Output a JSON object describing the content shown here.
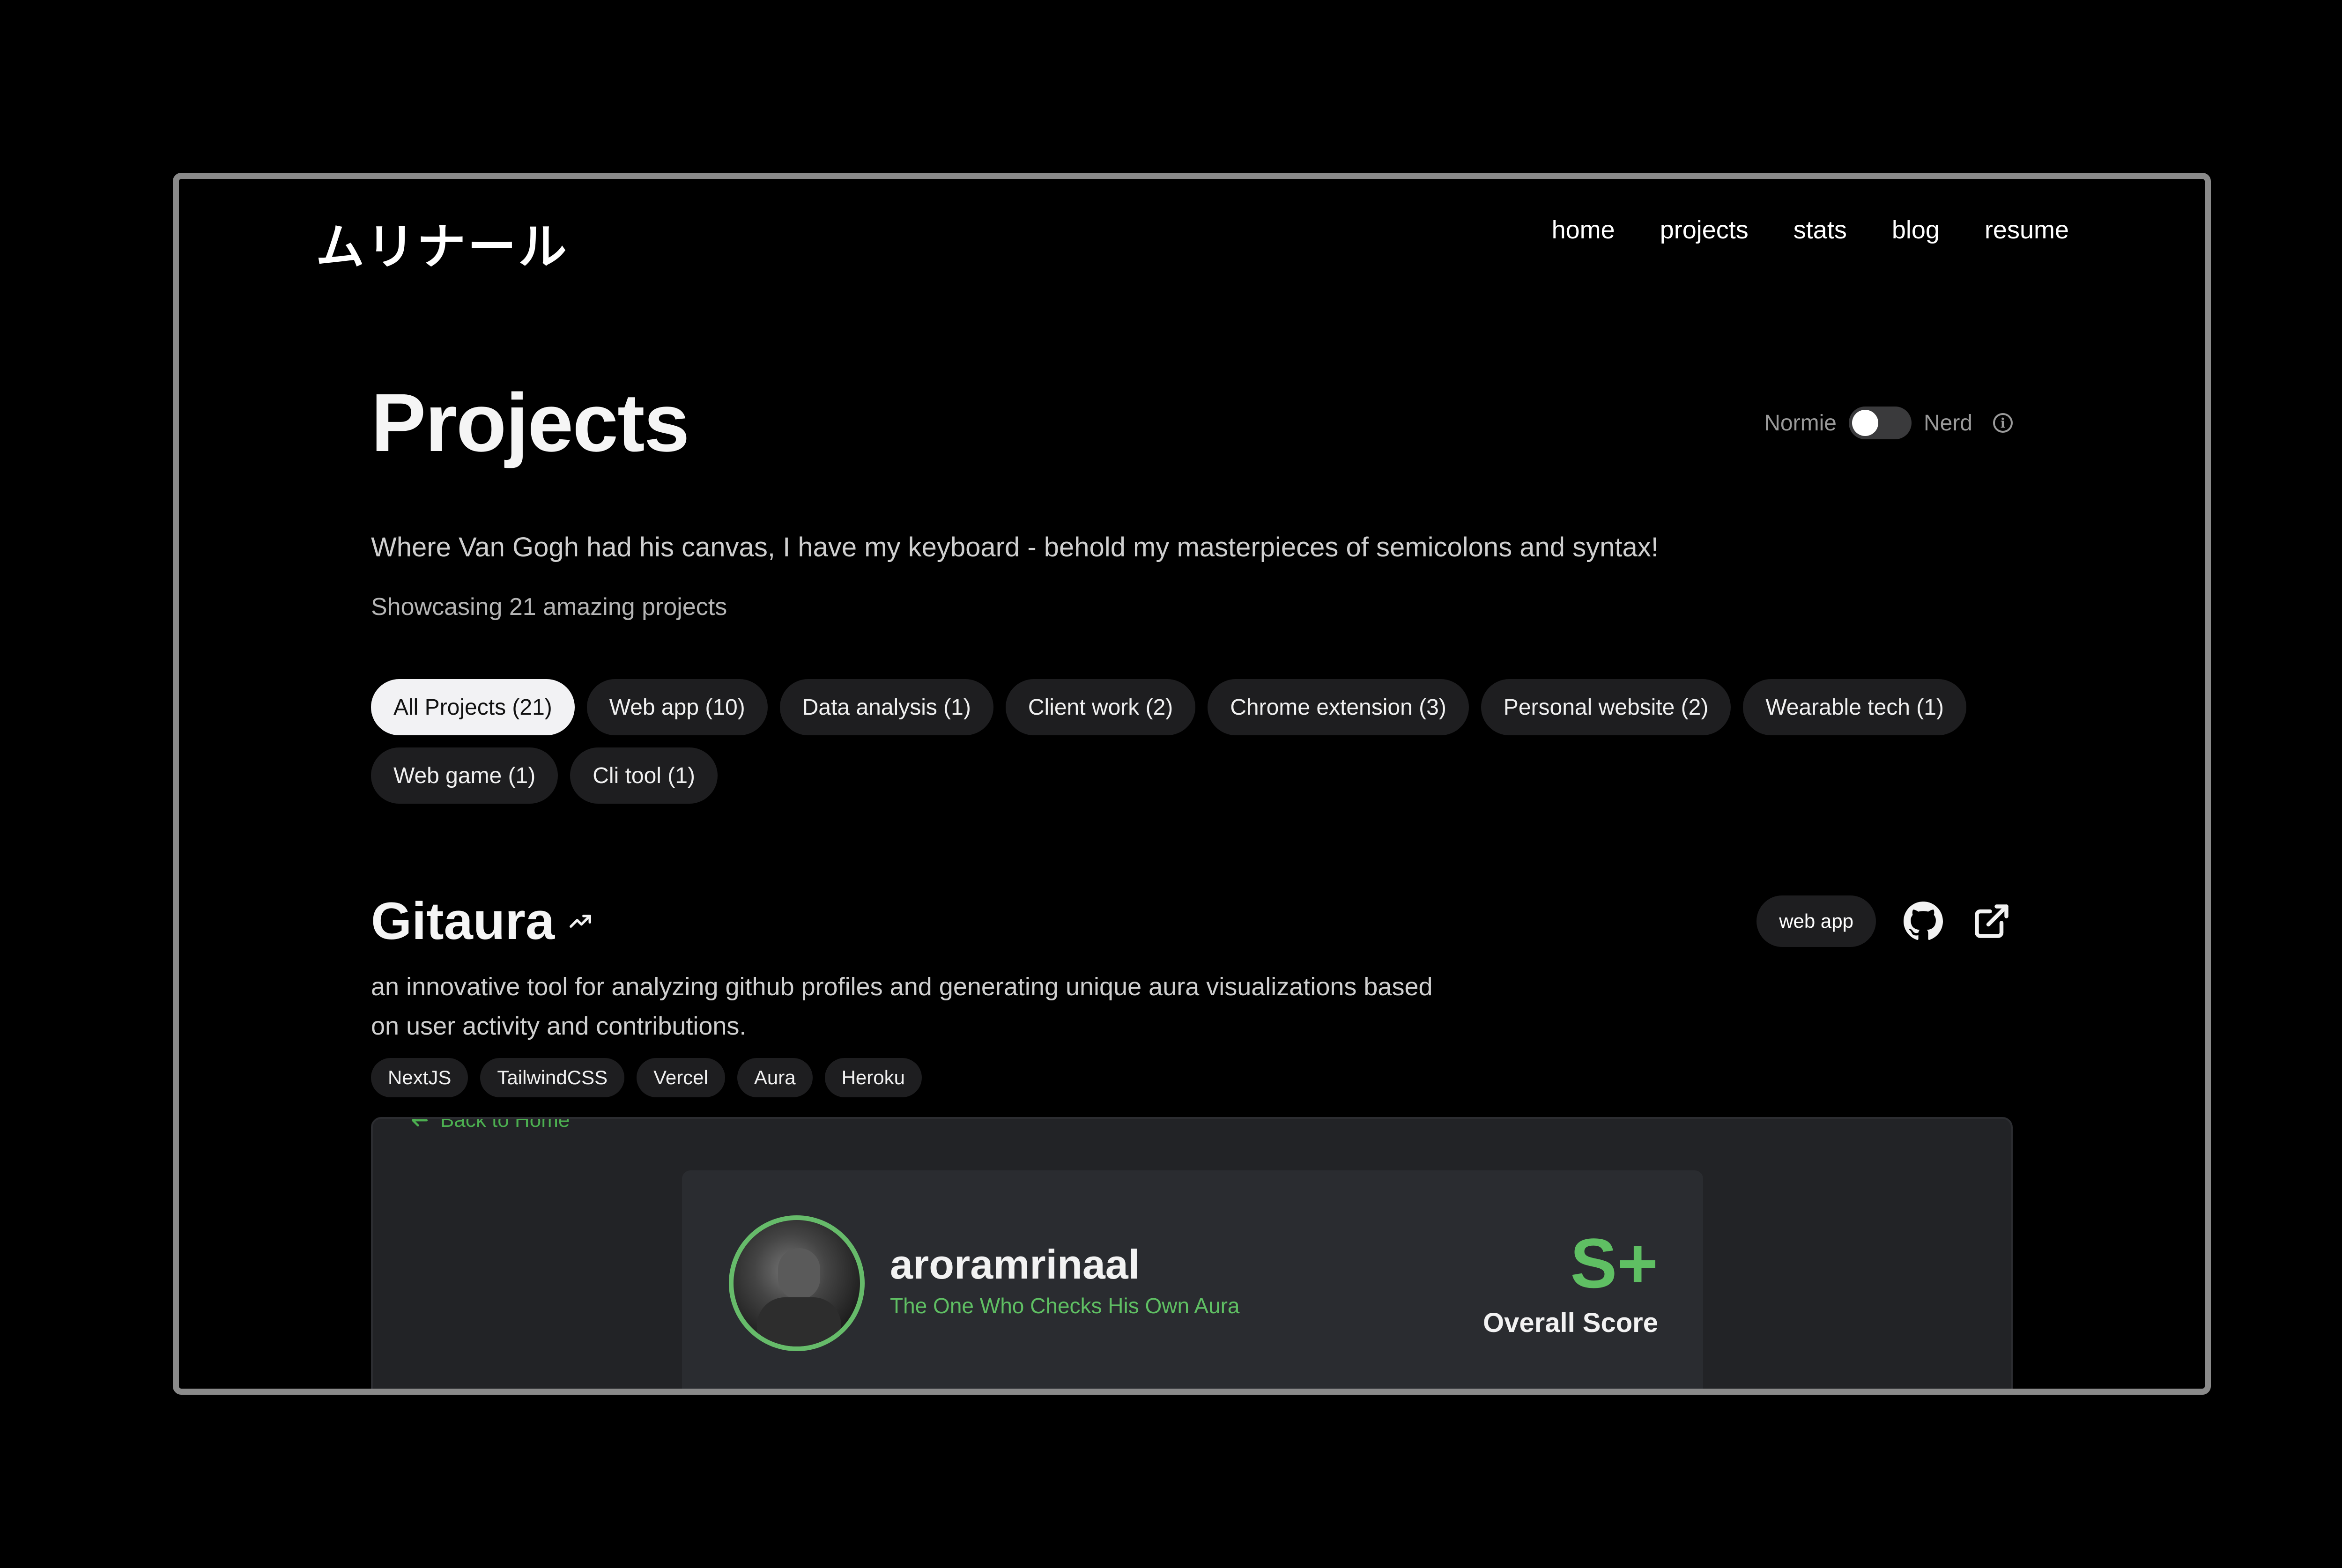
{
  "nav": {
    "logo": "ムリナール",
    "links": [
      "home",
      "projects",
      "stats",
      "blog",
      "resume"
    ]
  },
  "header": {
    "title": "Projects",
    "toggle_left": "Normie",
    "toggle_right": "Nerd",
    "toggle_on": false,
    "info_icon": "info-icon"
  },
  "intro": {
    "subtitle": "Where Van Gogh had his canvas, I have my keyboard - behold my masterpieces of semicolons and syntax!",
    "count": "Showcasing 21 amazing projects"
  },
  "filters": [
    "All Projects (21)",
    "Web app (10)",
    "Data analysis (1)",
    "Client work (2)",
    "Chrome extension (3)",
    "Personal website (2)",
    "Wearable tech (1)",
    "Web game (1)",
    "Cli tool (1)"
  ],
  "active_filter": "All Projects (21)",
  "project": {
    "title": "Gitaura",
    "category": "web app",
    "description": "an innovative tool for analyzing github profiles and generating unique aura visualizations based on user activity and contributions.",
    "tags": [
      "NextJS",
      "TailwindCSS",
      "Vercel",
      "Aura",
      "Heroku"
    ],
    "icons": [
      "trending-icon",
      "github-icon",
      "external-link-icon"
    ]
  },
  "preview": {
    "back_link": "Back to Home",
    "username": "aroramrinaal",
    "tagline": "The One Who Checks His Own Aura",
    "score": "S+",
    "score_label": "Overall Score"
  },
  "colors": {
    "background": "#000000",
    "chip": "#1e1e20",
    "chip_active": "#f2f2f4",
    "accent_green": "#5fbf63",
    "frame": "#8a8a8a"
  }
}
